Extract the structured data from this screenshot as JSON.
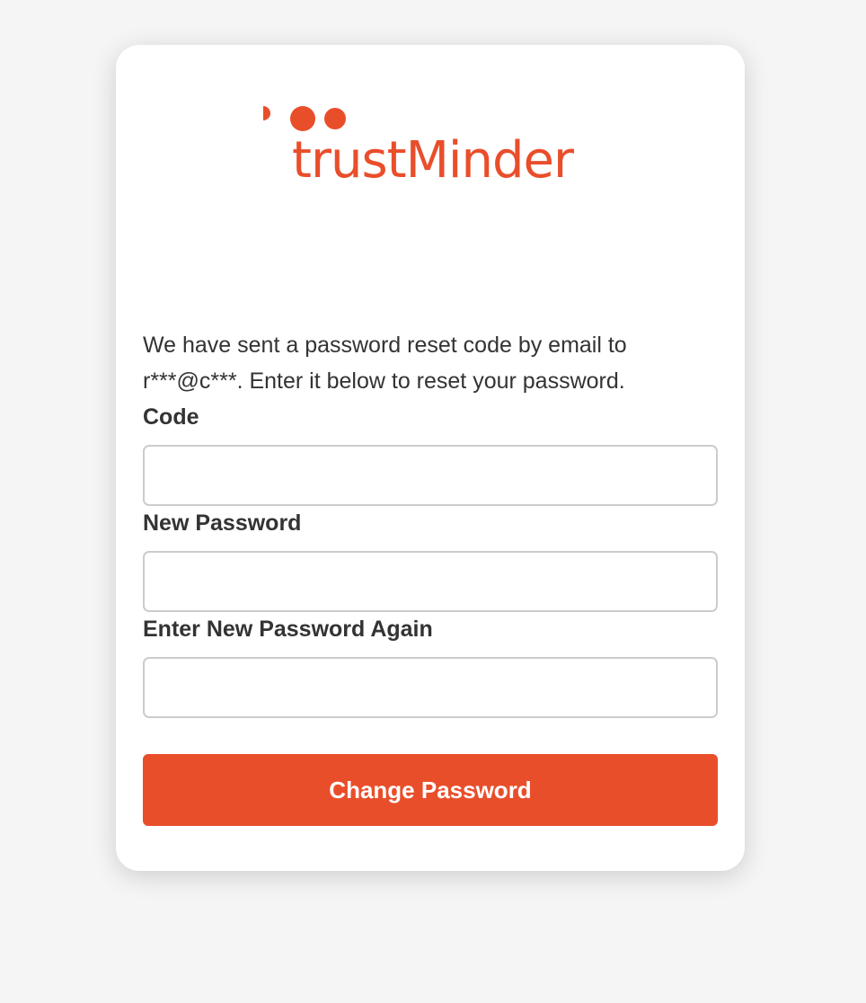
{
  "logo": {
    "text": "trustMinder",
    "color": "#e94e2b"
  },
  "form": {
    "message": "We have sent a password reset code by email to r***@c***. Enter it below to reset your password.",
    "code_label": "Code",
    "code_value": "",
    "new_password_label": "New Password",
    "new_password_value": "",
    "confirm_password_label": "Enter New Password Again",
    "confirm_password_value": "",
    "submit_label": "Change Password"
  },
  "colors": {
    "accent": "#e94e2b",
    "text": "#333333",
    "background": "#f5f5f5",
    "card": "#ffffff"
  }
}
